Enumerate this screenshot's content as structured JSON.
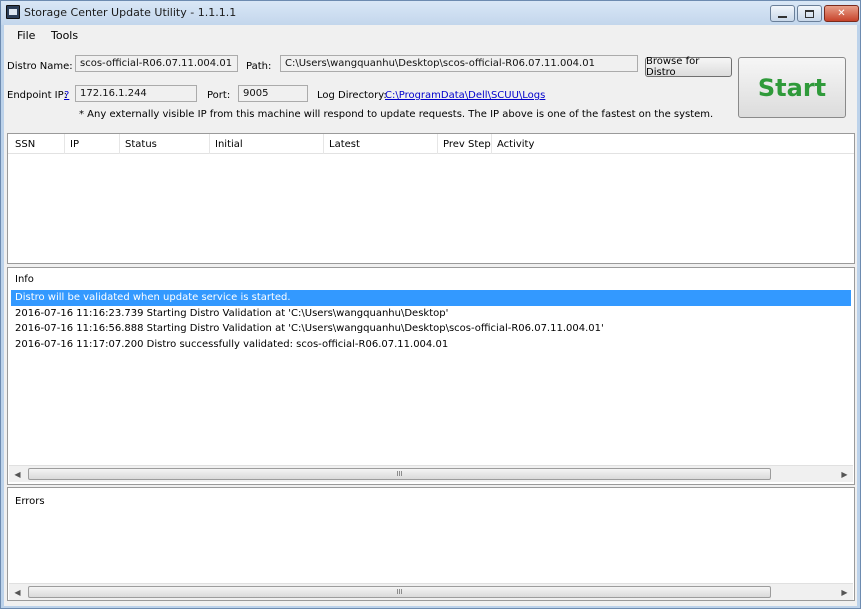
{
  "window": {
    "title": "Storage Center Update Utility - 1.1.1.1"
  },
  "menu": {
    "file": "File",
    "tools": "Tools"
  },
  "form": {
    "distro_name_label": "Distro Name:",
    "distro_name_value": "scos-official-R06.07.11.004.01",
    "path_label": "Path:",
    "path_value": "C:\\Users\\wangquanhu\\Desktop\\scos-official-R06.07.11.004.01",
    "browse_label": "Browse for Distro",
    "endpoint_label": "Endpoint IP:",
    "endpoint_help": "?",
    "endpoint_value": "172.16.1.244",
    "port_label": "Port:",
    "port_value": "9005",
    "log_dir_label": "Log Directory:",
    "log_dir_link": "C:\\ProgramData\\Dell\\SCUU\\Logs",
    "note": "* Any externally visible IP from this machine will respond to update requests.  The IP above is one of the fastest on the system.",
    "start_label": "Start"
  },
  "grid": {
    "columns": [
      "SSN",
      "IP",
      "Status",
      "Initial",
      "Latest",
      "Prev Step",
      "Activity"
    ]
  },
  "info": {
    "label": "Info",
    "rows": [
      "Distro will be validated when update service is started.",
      "2016-07-16 11:16:23.739 Starting Distro Validation at 'C:\\Users\\wangquanhu\\Desktop'",
      "2016-07-16 11:16:56.888 Starting Distro Validation at 'C:\\Users\\wangquanhu\\Desktop\\scos-official-R06.07.11.004.01'",
      "2016-07-16 11:17:07.200 Distro successfully validated: scos-official-R06.07.11.004.01"
    ],
    "selected_index": 0
  },
  "errors": {
    "label": "Errors"
  },
  "scrollbar": {
    "thumb_grip": "III"
  }
}
